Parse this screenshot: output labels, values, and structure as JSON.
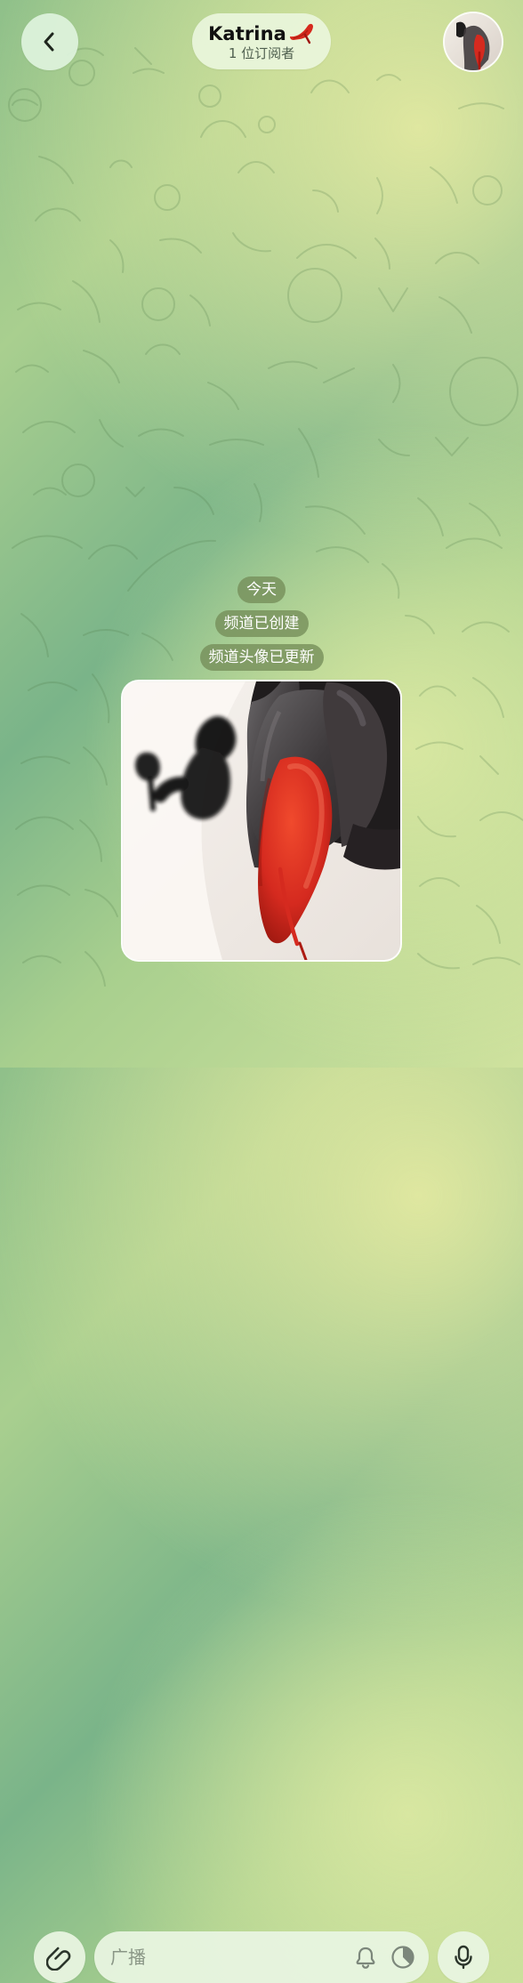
{
  "header": {
    "channel_name": "Katrina",
    "title_emoji": "high-heel-icon",
    "subscriber_count": "1 位订阅者"
  },
  "messages": {
    "service": [
      "今天",
      "频道已创建",
      "频道头像已更新"
    ]
  },
  "composer": {
    "placeholder": "广播"
  },
  "icons": {
    "back": "chevron-left-icon",
    "attach": "paperclip-icon",
    "bell": "bell-icon",
    "timer": "timer-icon",
    "mic": "microphone-icon"
  },
  "colors": {
    "pill_bg": "#748d58",
    "surface": "#e8f4e0",
    "accent_red": "#d9261c",
    "dark": "#111111"
  }
}
